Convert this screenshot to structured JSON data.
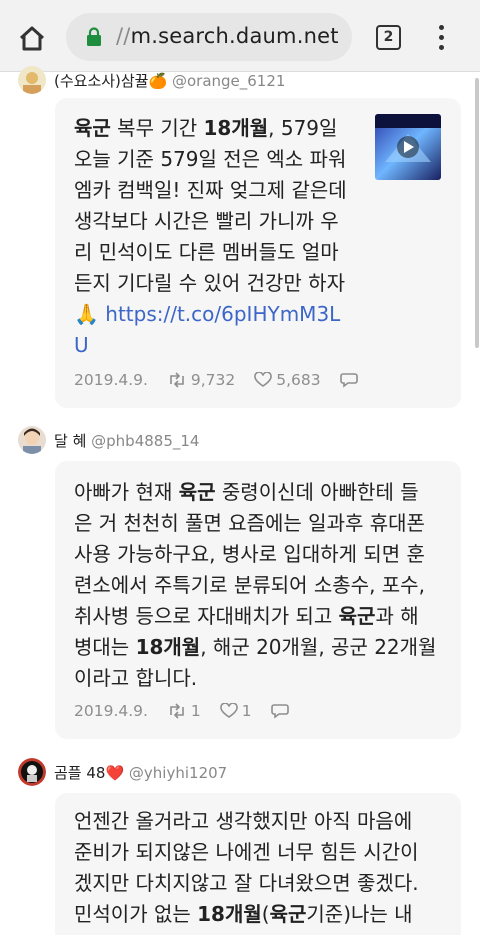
{
  "browser": {
    "url_scheme": "//",
    "url_host": "m.search.daum.net",
    "tab_count": "2"
  },
  "tweets": [
    {
      "author": "(수요소사)삼뀰🍊",
      "handle": "@orange_6121",
      "lines": [
        [
          {
            "t": "육군",
            "b": true
          },
          {
            "t": " 복무 기간 "
          },
          {
            "t": "18개월",
            "b": true
          },
          {
            "t": ", 579일"
          }
        ],
        [
          {
            "t": "오늘 기준 579일 전은 엑소 파워"
          }
        ],
        [
          {
            "t": "엠카 컴백일! 진짜 엊그제 같은데"
          }
        ],
        [
          {
            "t": "생각보다 시간은 빨리 가니까 우"
          }
        ],
        [
          {
            "t": "리 민석이도 다른 멤버들도 얼마"
          }
        ],
        [
          {
            "t": "든지 기다릴 수 있어 건강만 하자"
          }
        ],
        [
          {
            "t": "🙏 "
          },
          {
            "t": "https://t.co/6pIHYmM3L",
            "link": true
          }
        ],
        [
          {
            "t": "U",
            "link": true
          }
        ]
      ],
      "date": "2019.4.9.",
      "retweets": "9,732",
      "likes": "5,683"
    },
    {
      "author": "달 혜",
      "handle": "@phb4885_14",
      "lines": [
        [
          {
            "t": "아빠가 현재 "
          },
          {
            "t": "육군",
            "b": true
          },
          {
            "t": " 중령이신데 아빠한테 들"
          }
        ],
        [
          {
            "t": "은 거 천천히 풀면 요즘에는 일과후 휴대폰"
          }
        ],
        [
          {
            "t": "사용 가능하구요, 병사로 입대하게 되면 훈"
          }
        ],
        [
          {
            "t": "련소에서 주특기로 분류되어 소총수, 포수,"
          }
        ],
        [
          {
            "t": "취사병 등으로 자대배치가 되고 "
          },
          {
            "t": "육군",
            "b": true
          },
          {
            "t": "과 해"
          }
        ],
        [
          {
            "t": "병대는 "
          },
          {
            "t": "18개월",
            "b": true
          },
          {
            "t": ", 해군 20개월, 공군 22개월"
          }
        ],
        [
          {
            "t": "이라고 합니다."
          }
        ]
      ],
      "date": "2019.4.9.",
      "retweets": "1",
      "likes": "1"
    },
    {
      "author": "곰플 48❤️",
      "handle": "@yhiyhi1207",
      "lines": [
        [
          {
            "t": "언젠간 올거라고 생각했지만 아직 마음에"
          }
        ],
        [
          {
            "t": "준비가 되지않은 나에겐 너무 힘든 시간이"
          }
        ],
        [
          {
            "t": "겠지만 다치지않고 잘 다녀왔으면 좋겠다."
          }
        ],
        [
          {
            "t": "민석이가 없는 "
          },
          {
            "t": "18개월",
            "b": true
          },
          {
            "t": "("
          },
          {
            "t": "육군",
            "b": true
          },
          {
            "t": "기준)나는 내"
          }
        ]
      ]
    }
  ]
}
